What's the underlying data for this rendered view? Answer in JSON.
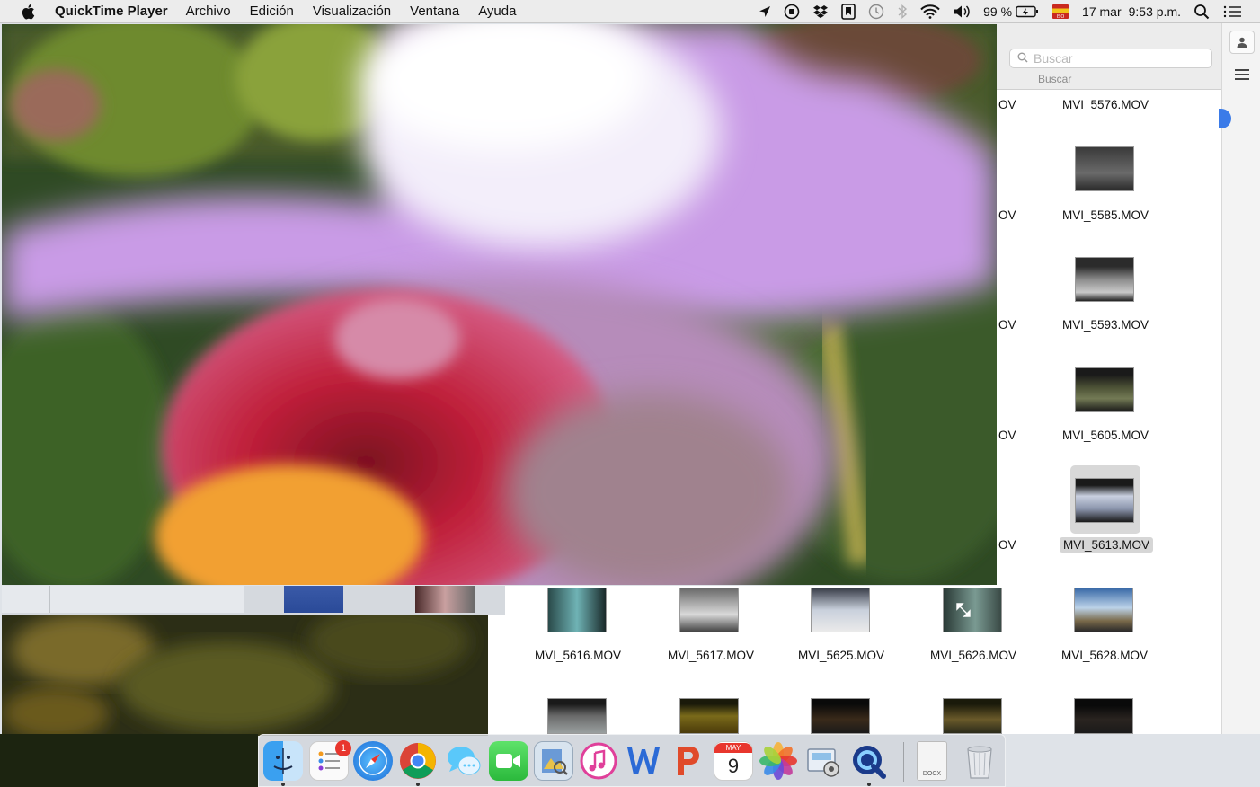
{
  "menubar": {
    "app_name": "QuickTime Player",
    "menus": [
      "Archivo",
      "Edición",
      "Visualización",
      "Ventana",
      "Ayuda"
    ],
    "battery": "99 %",
    "date": "17 mar",
    "time": "9:53 p.m."
  },
  "finder": {
    "search_placeholder": "Buscar",
    "search_label": "Buscar",
    "partial_label": "OV",
    "files_right_column": [
      "MVI_5576.MOV",
      "MVI_5585.MOV",
      "MVI_5593.MOV",
      "MVI_5605.MOV",
      "MVI_5613.MOV",
      "MVI_5628.MOV"
    ],
    "files_bottom_row": [
      "MVI_5616.MOV",
      "MVI_5617.MOV",
      "MVI_5625.MOV",
      "MVI_5626.MOV"
    ],
    "selected_file": "MVI_5613.MOV"
  },
  "dock": {
    "apps": [
      "Finder",
      "Recordatorios",
      "Safari",
      "Google Chrome",
      "Mensajes",
      "FaceTime",
      "Vista Previa",
      "iTunes",
      "Microsoft Word",
      "Microsoft PowerPoint",
      "Calendario",
      "Fotos",
      "Captura de Pantalla",
      "QuickTime Player",
      "Documento",
      "Papelera"
    ],
    "reminders_badge": "1",
    "calendar_month": "MAY",
    "calendar_day": "9",
    "doc_label": "DOCX"
  }
}
